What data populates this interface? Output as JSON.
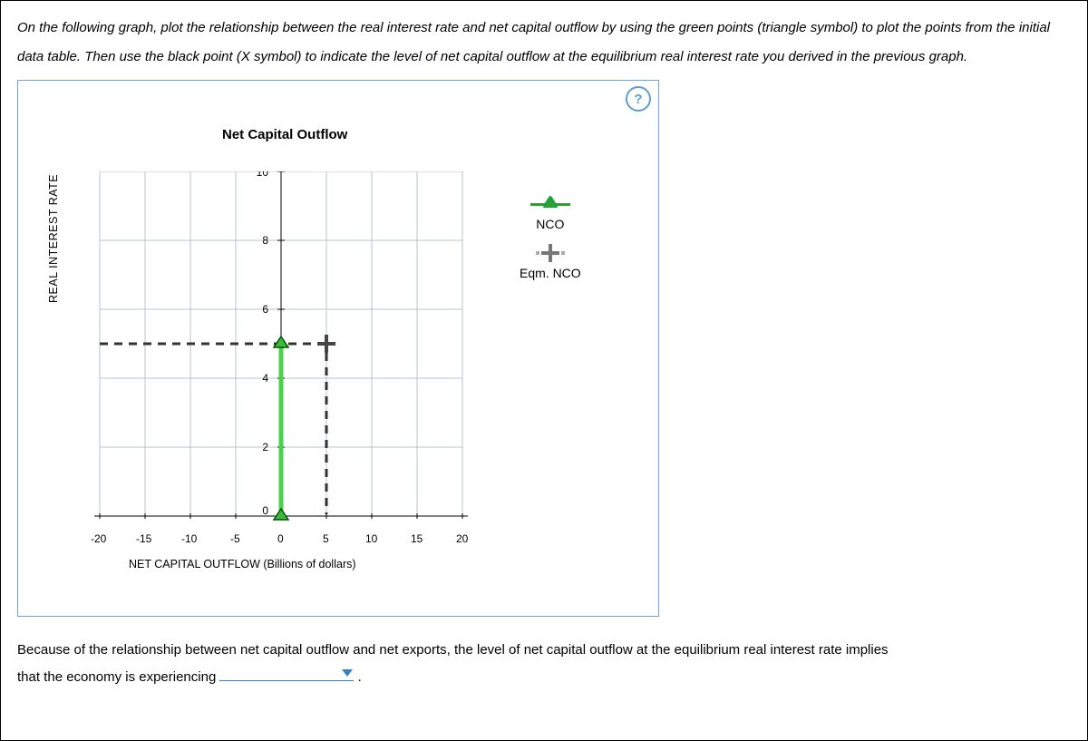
{
  "instructions": "On the following graph, plot the relationship between the real interest rate and net capital outflow by using the green points (triangle symbol) to plot the points from the initial data table. Then use the black point (X symbol) to indicate the level of net capital outflow at the equilibrium real interest rate you derived in the previous graph.",
  "chart_data": {
    "type": "scatter",
    "title": "Net Capital Outflow",
    "xlabel": "NET CAPITAL OUTFLOW (Billions of dollars)",
    "ylabel": "REAL INTEREST RATE",
    "xlim": [
      -20,
      20
    ],
    "ylim": [
      0,
      10
    ],
    "x_ticks": [
      -20,
      -15,
      -10,
      -5,
      0,
      5,
      10,
      15,
      20
    ],
    "y_ticks": [
      0,
      2,
      4,
      6,
      8,
      10
    ],
    "series": [
      {
        "name": "NCO",
        "symbol": "triangle",
        "color": "#2e9e2e",
        "points": [
          {
            "x": 0,
            "y": 0
          },
          {
            "x": 0,
            "y": 5
          }
        ]
      },
      {
        "name": "Eqm. NCO",
        "symbol": "plus",
        "color": "#666",
        "points": [
          {
            "x": 5,
            "y": 5
          }
        ],
        "guides": [
          {
            "type": "h",
            "y": 5,
            "x_from": -20,
            "x_to": 5
          },
          {
            "type": "v",
            "x": 5,
            "y_from": 0,
            "y_to": 5
          }
        ]
      }
    ]
  },
  "legend": {
    "nco": "NCO",
    "eqm": "Eqm. NCO"
  },
  "help": "?",
  "bottom": {
    "line1a": "Because of the relationship between net capital outflow and net exports, the level of net capital outflow at the equilibrium real interest rate implies",
    "line2a": "that the economy is experiencing",
    "dropdown_value": "",
    "period": "."
  }
}
